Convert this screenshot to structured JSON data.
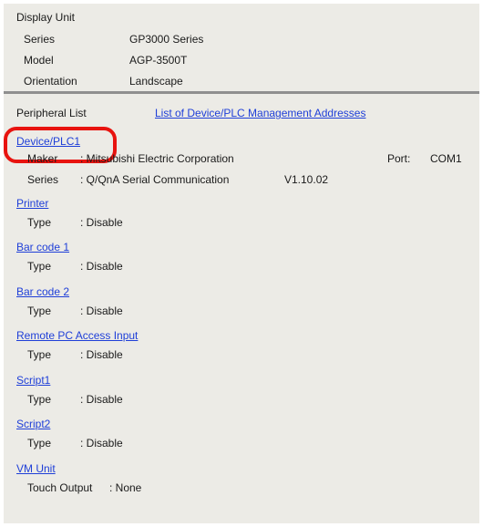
{
  "display_unit": {
    "heading": "Display Unit",
    "rows": [
      {
        "label": "Series",
        "value": "GP3000 Series"
      },
      {
        "label": "Model",
        "value": "AGP-3500T"
      },
      {
        "label": "Orientation",
        "value": "Landscape"
      }
    ]
  },
  "peripheral": {
    "heading": "Peripheral List",
    "management_link": "List of Device/PLC Management Addresses"
  },
  "device_plc": {
    "title": "Device/PLC1",
    "maker_label": "Maker",
    "maker_value": ": Mitsubishi Electric Corporation",
    "port_label": "Port:",
    "port_value": "COM1",
    "series_label": "Series",
    "series_value": ": Q/QnA Serial Communication",
    "version": "V1.10.02"
  },
  "sections": [
    {
      "title": "Printer",
      "label": "Type",
      "value": ": Disable"
    },
    {
      "title": "Bar code 1",
      "label": "Type",
      "value": ": Disable"
    },
    {
      "title": "Bar code 2",
      "label": "Type",
      "value": ": Disable"
    },
    {
      "title": "Remote PC Access Input",
      "label": "Type",
      "value": ": Disable"
    },
    {
      "title": "Script1",
      "label": "Type",
      "value": ": Disable"
    },
    {
      "title": "Script2",
      "label": "Type",
      "value": ": Disable"
    },
    {
      "title": "VM Unit",
      "label": "Touch Output",
      "value": ": None"
    }
  ],
  "colors": {
    "highlight": "#e8130f",
    "link": "#1f3fd8",
    "panel": "#ecebe6"
  }
}
